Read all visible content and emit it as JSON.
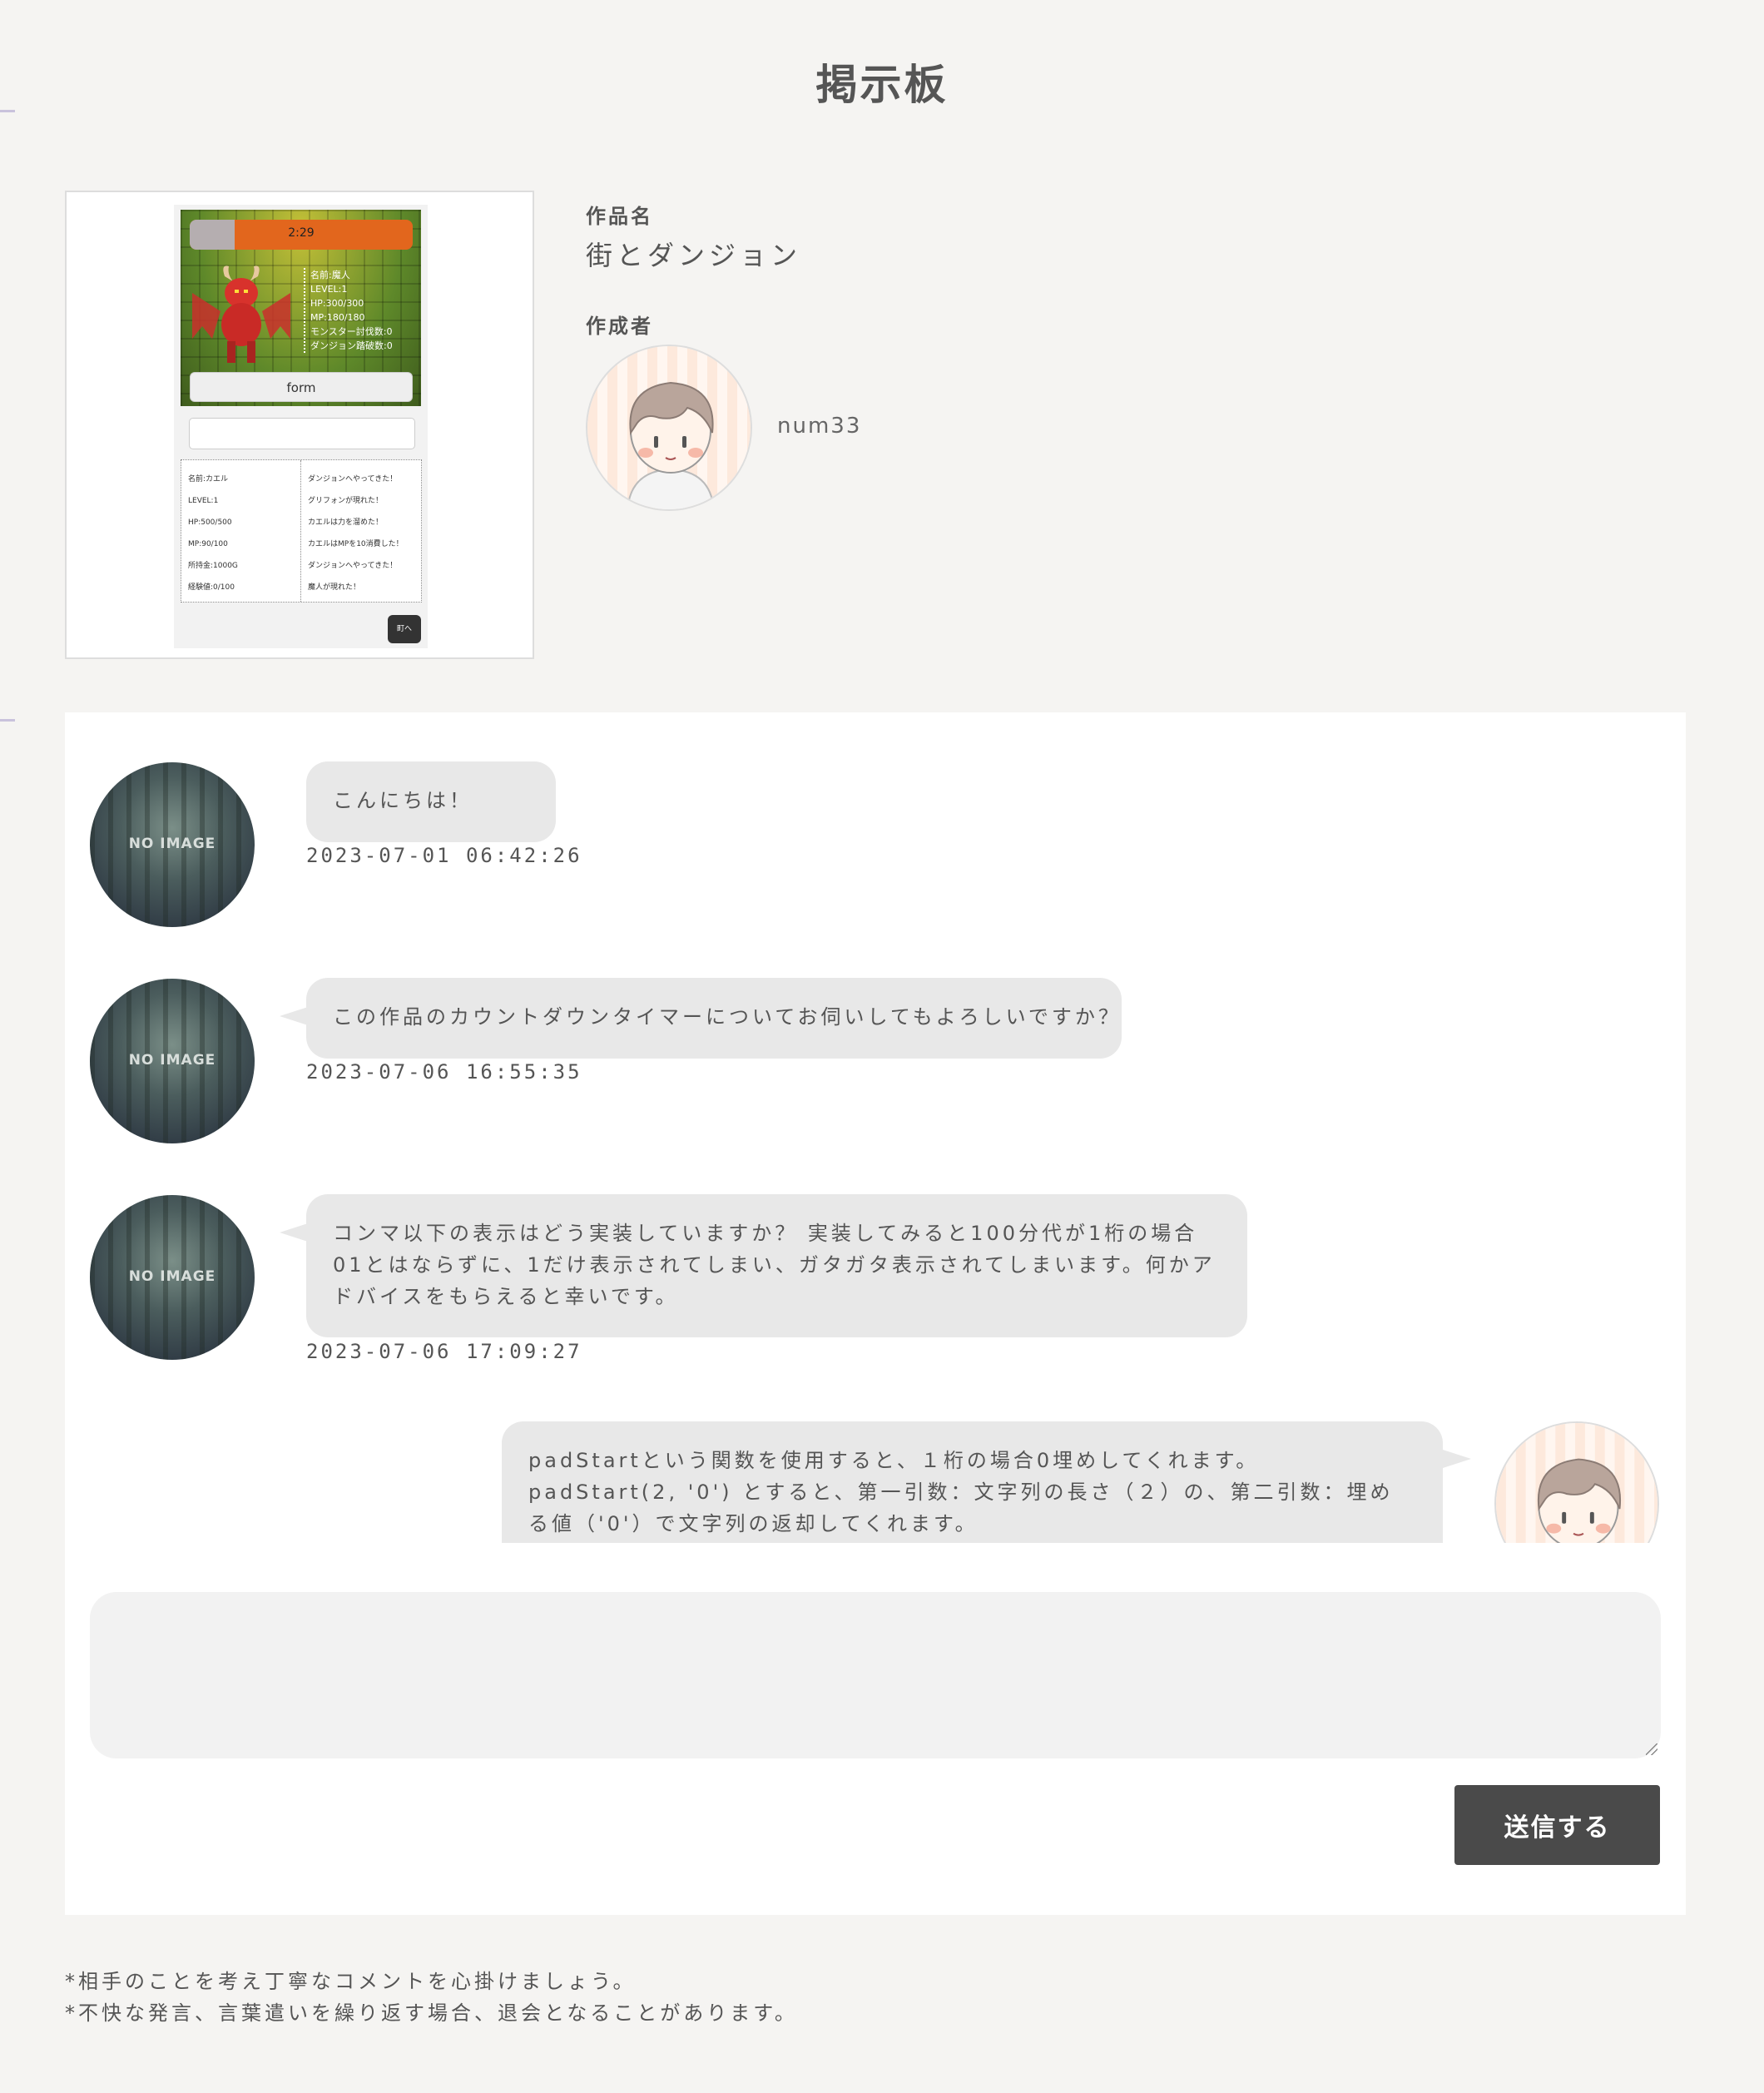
{
  "page": {
    "title": "掲示板"
  },
  "work": {
    "title_label": "作品名",
    "title": "街とダンジョン",
    "author_label": "作成者",
    "author_name": "num33",
    "thumbnail": {
      "timer": "2:29",
      "timer_fill": 0.2,
      "monster_stats": [
        "名前:魔人",
        "LEVEL:1",
        "HP:300/300",
        "MP:180/180",
        "モンスター討伐数:0",
        "ダンジョン踏破数:0"
      ],
      "form_button": "form",
      "player_stats": [
        "名前:カエル",
        "LEVEL:1",
        "HP:500/500",
        "MP:90/100",
        "所持金:1000G",
        "経験値:0/100"
      ],
      "log": [
        "ダンジョンへやってきた！",
        "グリフォンが現れた！",
        "カエルは力を溜めた！",
        "カエルはMPを10消費した！",
        "ダンジョンへやってきた！",
        "魔人が現れた！"
      ],
      "town_button": "町へ"
    }
  },
  "messages": [
    {
      "text": "こんにちは！",
      "timestamp": "2023-07-01 06:42:26",
      "avatar": "NO IMAGE"
    },
    {
      "text": "この作品のカウントダウンタイマーについてお伺いしてもよろしいですか？",
      "timestamp": "2023-07-06 16:55:35",
      "avatar": "NO IMAGE"
    },
    {
      "text": "コンマ以下の表示はどう実装していますか？ 実装してみると100分代が1桁の場合01とはならずに、1だけ表示されてしまい、ガタガタ表示されてしまいます。何かアドバイスをもらえると幸いです。",
      "timestamp": "2023-07-06 17:09:27",
      "avatar": "NO IMAGE"
    },
    {
      "text": "padStartという関数を使用すると、１桁の場合0埋めしてくれます。 padStart(2, '0') とすると、第一引数：文字列の長さ（２）の、第二引数：埋める値（'0'）で文字列の返却してくれます。"
    }
  ],
  "form": {
    "send_label": "送信する",
    "placeholder": ""
  },
  "notes": [
    "*相手のことを考え丁寧なコメントを心掛けましょう。",
    "*不快な発言、言葉遣いを繰り返す場合、退会となることがあります。"
  ],
  "colors": {
    "background": "#f5f4f2",
    "bubble": "#e8e8e8",
    "button": "#4a4a4a"
  }
}
